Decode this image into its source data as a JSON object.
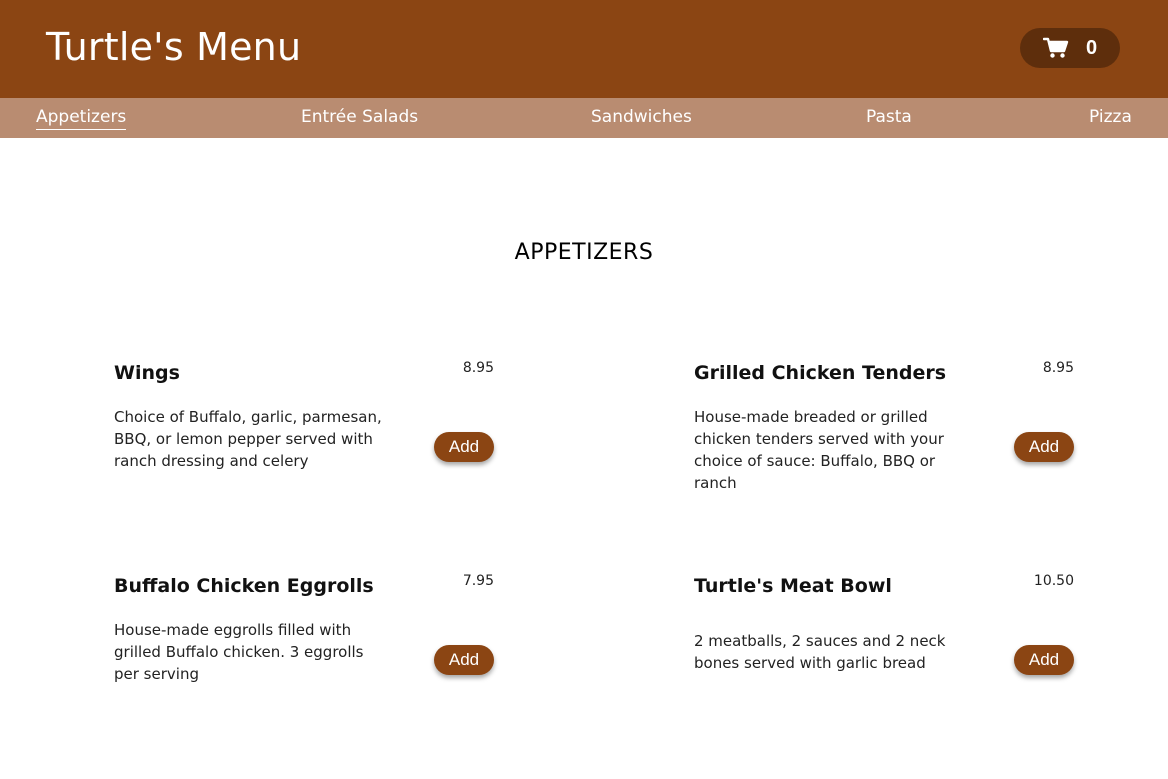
{
  "header": {
    "title": "Turtle's Menu",
    "cart_count": "0"
  },
  "nav": {
    "items": [
      {
        "label": "Appetizers",
        "active": true
      },
      {
        "label": "Entrée Salads",
        "active": false
      },
      {
        "label": "Sandwiches",
        "active": false
      },
      {
        "label": "Pasta",
        "active": false
      },
      {
        "label": "Pizza",
        "active": false
      }
    ]
  },
  "section": {
    "title": "APPETIZERS"
  },
  "menu": {
    "items": [
      {
        "name": "Wings",
        "price": "8.95",
        "description": "Choice of Buffalo, garlic, parmesan, BBQ, or lemon pepper served with ranch dressing and celery",
        "button": "Add"
      },
      {
        "name": "Grilled Chicken Tenders",
        "price": "8.95",
        "description": "House-made breaded or grilled chicken tenders served with your choice of sauce: Buffalo, BBQ or ranch",
        "button": "Add"
      },
      {
        "name": "Buffalo Chicken Eggrolls",
        "price": "7.95",
        "description": "House-made eggrolls filled with grilled Buffalo chicken. 3 eggrolls per serving",
        "button": "Add"
      },
      {
        "name": "Turtle's Meat Bowl",
        "price": "10.50",
        "description": "2 meatballs, 2 sauces and 2 neck bones served with garlic bread",
        "button": "Add"
      }
    ]
  },
  "colors": {
    "header_bg": "#8b4513",
    "nav_bg": "#b98c71",
    "cart_bg": "#5e2e0c",
    "button_bg": "#8b4513"
  },
  "icons": {
    "cart": "shopping-cart-icon"
  }
}
